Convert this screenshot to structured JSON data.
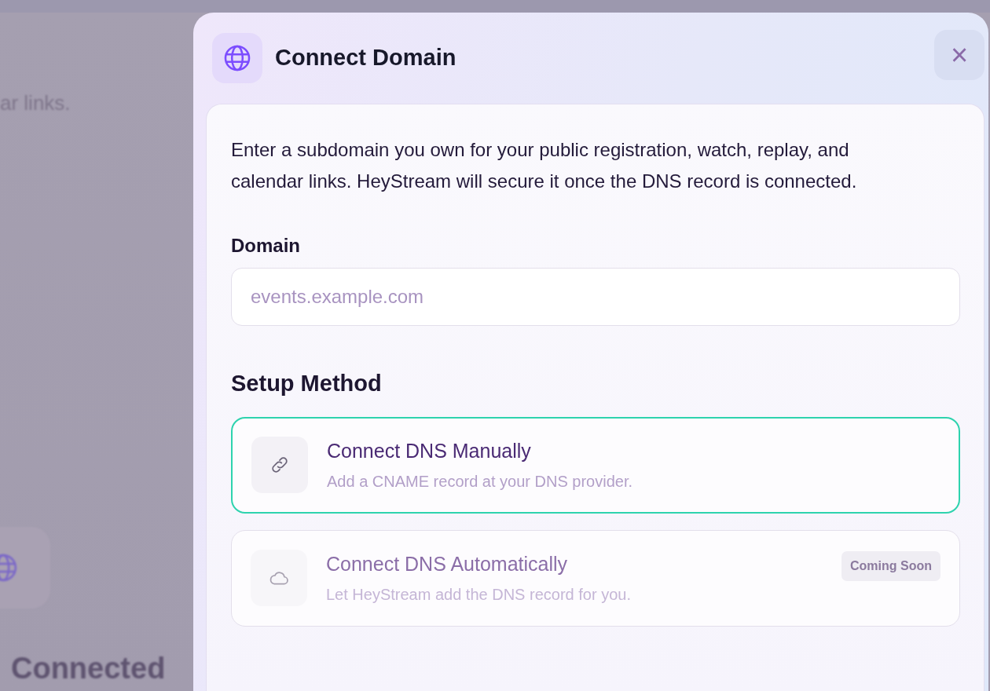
{
  "background": {
    "texts": [
      "ar links.",
      "Connected"
    ]
  },
  "dialog": {
    "title": "Connect Domain",
    "close": "×",
    "description": "Enter a subdomain you own for your public registration, watch, replay, and calendar links. HeyStream will secure it once the DNS record is connected.",
    "domain": {
      "label": "Domain",
      "placeholder": "events.example.com"
    },
    "setup_heading": "Setup Method",
    "options": [
      {
        "title": "Connect DNS Manually",
        "subtitle": "Add a CNAME record at your DNS provider.",
        "selected": true,
        "disabled": false
      },
      {
        "title": "Connect DNS Automatically",
        "subtitle": "Let HeyStream add the DNS record for you.",
        "selected": false,
        "disabled": true,
        "badge": "Coming Soon"
      }
    ]
  }
}
